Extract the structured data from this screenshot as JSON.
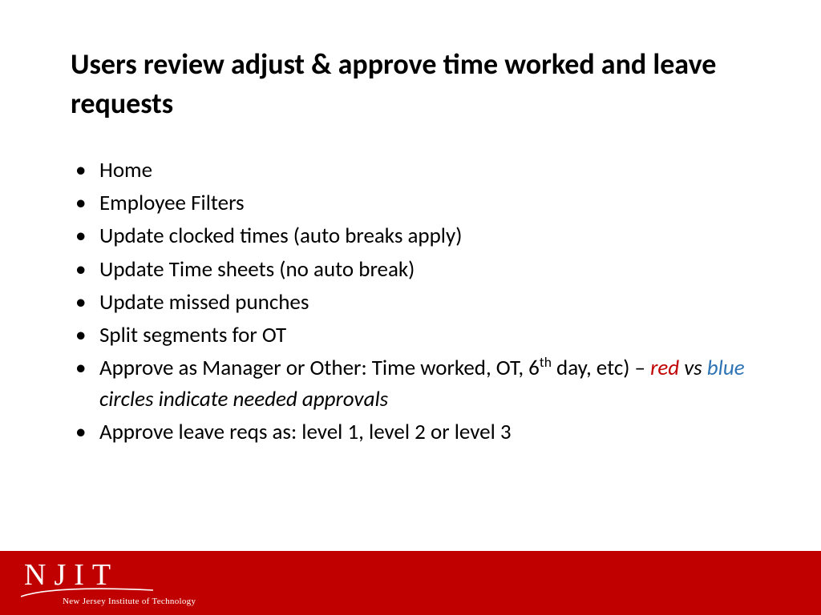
{
  "title": "Users review adjust & approve time worked and leave requests",
  "bullets": [
    "Home",
    "Employee Filters",
    "Update clocked times (auto breaks apply)",
    "Update Time sheets (no auto break)",
    "Update missed punches",
    "Split segments for OT"
  ],
  "bullet7_a": "Approve as Manager or Other:  Time worked, OT, 6",
  "bullet7_sup": "th",
  "bullet7_b": " day, etc) – ",
  "bullet7_red": "red",
  "bullet7_vs": " vs ",
  "bullet7_blue": "blue",
  "bullet7_c": " circles indicate needed approvals",
  "bullet8": "Approve leave reqs as:  level 1, level 2 or level 3",
  "footer": {
    "logo_letters": "NJIT",
    "tagline": "New Jersey Institute of Technology"
  }
}
